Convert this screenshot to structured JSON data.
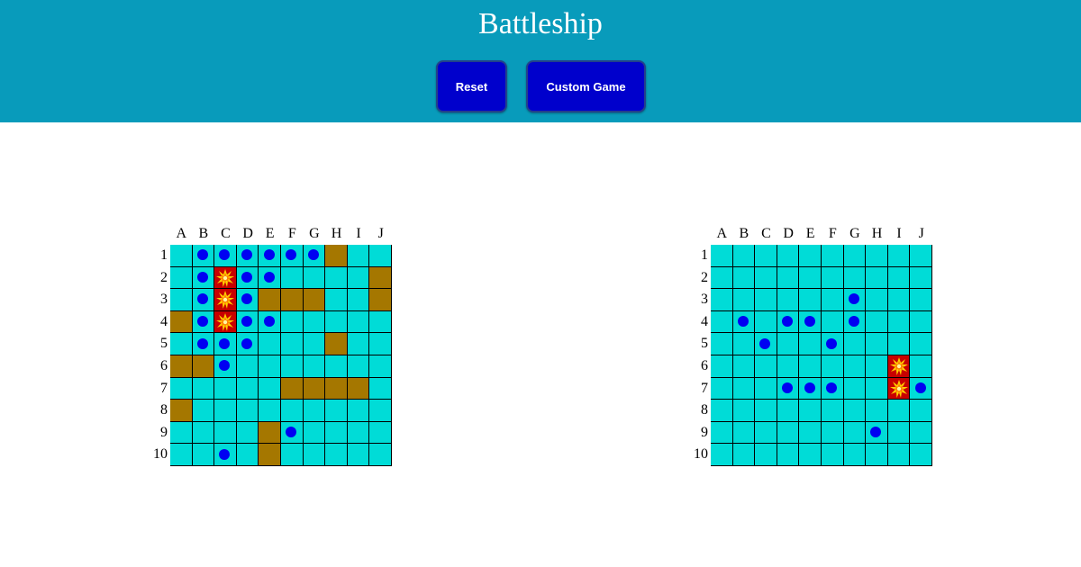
{
  "header": {
    "title": "Battleship",
    "reset_label": "Reset",
    "custom_label": "Custom Game"
  },
  "colors": {
    "header_bg": "#089bbb",
    "button_bg": "#0000cc",
    "water": "#00dcd7",
    "ship": "#a57700",
    "hit": "#c80000",
    "miss_marker": "#0000f2"
  },
  "icons": {
    "miss": "miss-dot-icon",
    "hit": "explosion-icon"
  },
  "columns": [
    "A",
    "B",
    "C",
    "D",
    "E",
    "F",
    "G",
    "H",
    "I",
    "J"
  ],
  "rows": [
    "1",
    "2",
    "3",
    "4",
    "5",
    "6",
    "7",
    "8",
    "9",
    "10"
  ],
  "boards": [
    {
      "id": "player",
      "cells": [
        "-MMMMMMS--",
        "-MHMM----S",
        "-MHMSSS--S",
        "SMHMM-----",
        "-MMM---S--",
        "SSM-------",
        "-----SSSS-",
        "S---------",
        "----SM----",
        "--M-S-----"
      ]
    },
    {
      "id": "opponent",
      "cells": [
        "----------",
        "----------",
        "------M---",
        "-M-MM-M---",
        "--M--M----",
        "--------H-",
        "---MMM--HM",
        "----------",
        "-------M--",
        "----------"
      ]
    }
  ]
}
